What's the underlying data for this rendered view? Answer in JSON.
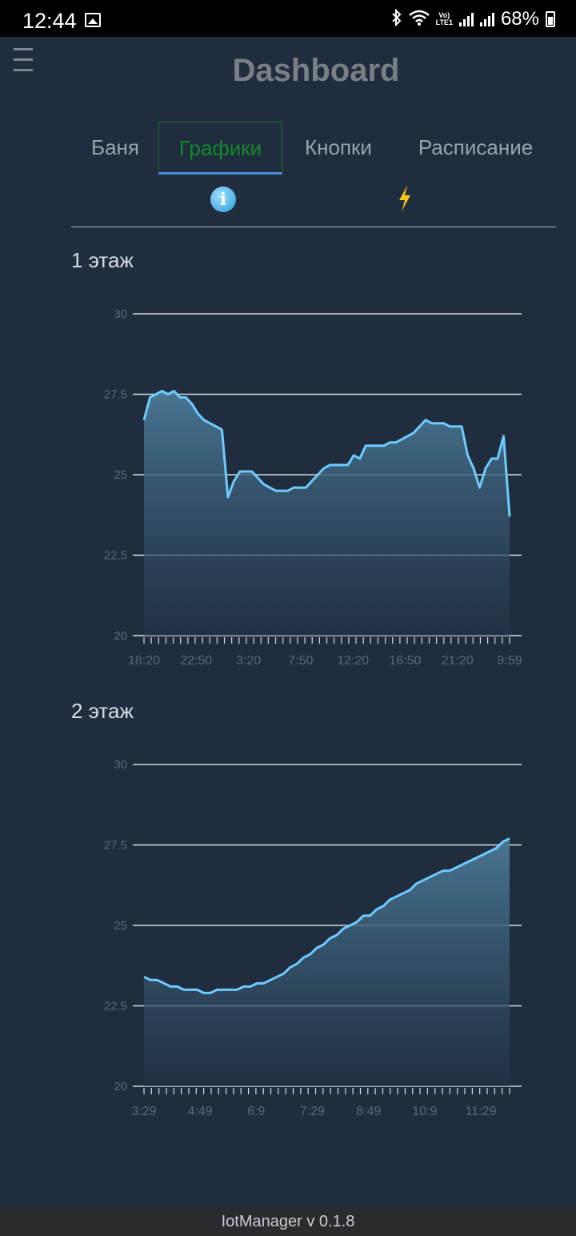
{
  "status_bar": {
    "time": "12:44",
    "battery": "68%",
    "volte_top": "Vo)",
    "volte_bottom": "LTE1"
  },
  "header": {
    "title": "Dashboard",
    "menu_icon": "hamburger-icon"
  },
  "tabs": [
    {
      "label": "Баня",
      "active": false
    },
    {
      "label": "Графики",
      "active": true
    },
    {
      "label": "Кнопки",
      "active": false
    },
    {
      "label": "Расписание",
      "active": false
    }
  ],
  "sub_icons": {
    "info": "info-icon",
    "bolt": "lightning-icon"
  },
  "colors": {
    "background": "#1f2d3e",
    "line": "#6ecbff",
    "active_tab": "#138a2a",
    "tab_underline": "#4a8ed8"
  },
  "chart_data": [
    {
      "type": "area",
      "title": "1 этаж",
      "ylim": [
        20,
        30
      ],
      "yticks": [
        "20",
        "22.5",
        "25",
        "27.5",
        "30"
      ],
      "xticks": [
        "18:20",
        "22:50",
        "3:20",
        "7:50",
        "12:20",
        "16:50",
        "21:20",
        "9:59"
      ],
      "tick_count": 51,
      "grid": true,
      "values": [
        26.7,
        27.4,
        27.5,
        27.6,
        27.5,
        27.6,
        27.4,
        27.4,
        27.2,
        26.9,
        26.7,
        26.6,
        26.5,
        26.4,
        24.3,
        24.8,
        25.1,
        25.1,
        25.1,
        24.9,
        24.7,
        24.6,
        24.5,
        24.5,
        24.5,
        24.6,
        24.6,
        24.6,
        24.8,
        25.0,
        25.2,
        25.3,
        25.3,
        25.3,
        25.3,
        25.6,
        25.5,
        25.9,
        25.9,
        25.9,
        25.9,
        26.0,
        26.0,
        26.1,
        26.2,
        26.3,
        26.5,
        26.7,
        26.6,
        26.6,
        26.6,
        26.5,
        26.5,
        26.5,
        25.6,
        25.2,
        24.6,
        25.2,
        25.5,
        25.5,
        26.2,
        23.7
      ]
    },
    {
      "type": "area",
      "title": "2 этаж",
      "ylim": [
        20,
        30
      ],
      "yticks": [
        "20",
        "22.5",
        "25",
        "27.5",
        "30"
      ],
      "xticks": [
        "3:29",
        "4:49",
        "6:9",
        "7:29",
        "8:49",
        "10:9",
        "11:29"
      ],
      "tick_count": 50,
      "grid": true,
      "values": [
        23.4,
        23.3,
        23.3,
        23.2,
        23.1,
        23.1,
        23.0,
        23.0,
        23.0,
        22.9,
        22.9,
        23.0,
        23.0,
        23.0,
        23.0,
        23.1,
        23.1,
        23.2,
        23.2,
        23.3,
        23.4,
        23.5,
        23.7,
        23.8,
        24.0,
        24.1,
        24.3,
        24.4,
        24.6,
        24.7,
        24.9,
        25.0,
        25.1,
        25.3,
        25.3,
        25.5,
        25.6,
        25.8,
        25.9,
        26.0,
        26.1,
        26.3,
        26.4,
        26.5,
        26.6,
        26.7,
        26.7,
        26.8,
        26.9,
        27.0,
        27.1,
        27.2,
        27.3,
        27.4,
        27.6,
        27.7
      ]
    }
  ],
  "footer": {
    "text": "IotManager v 0.1.8"
  }
}
